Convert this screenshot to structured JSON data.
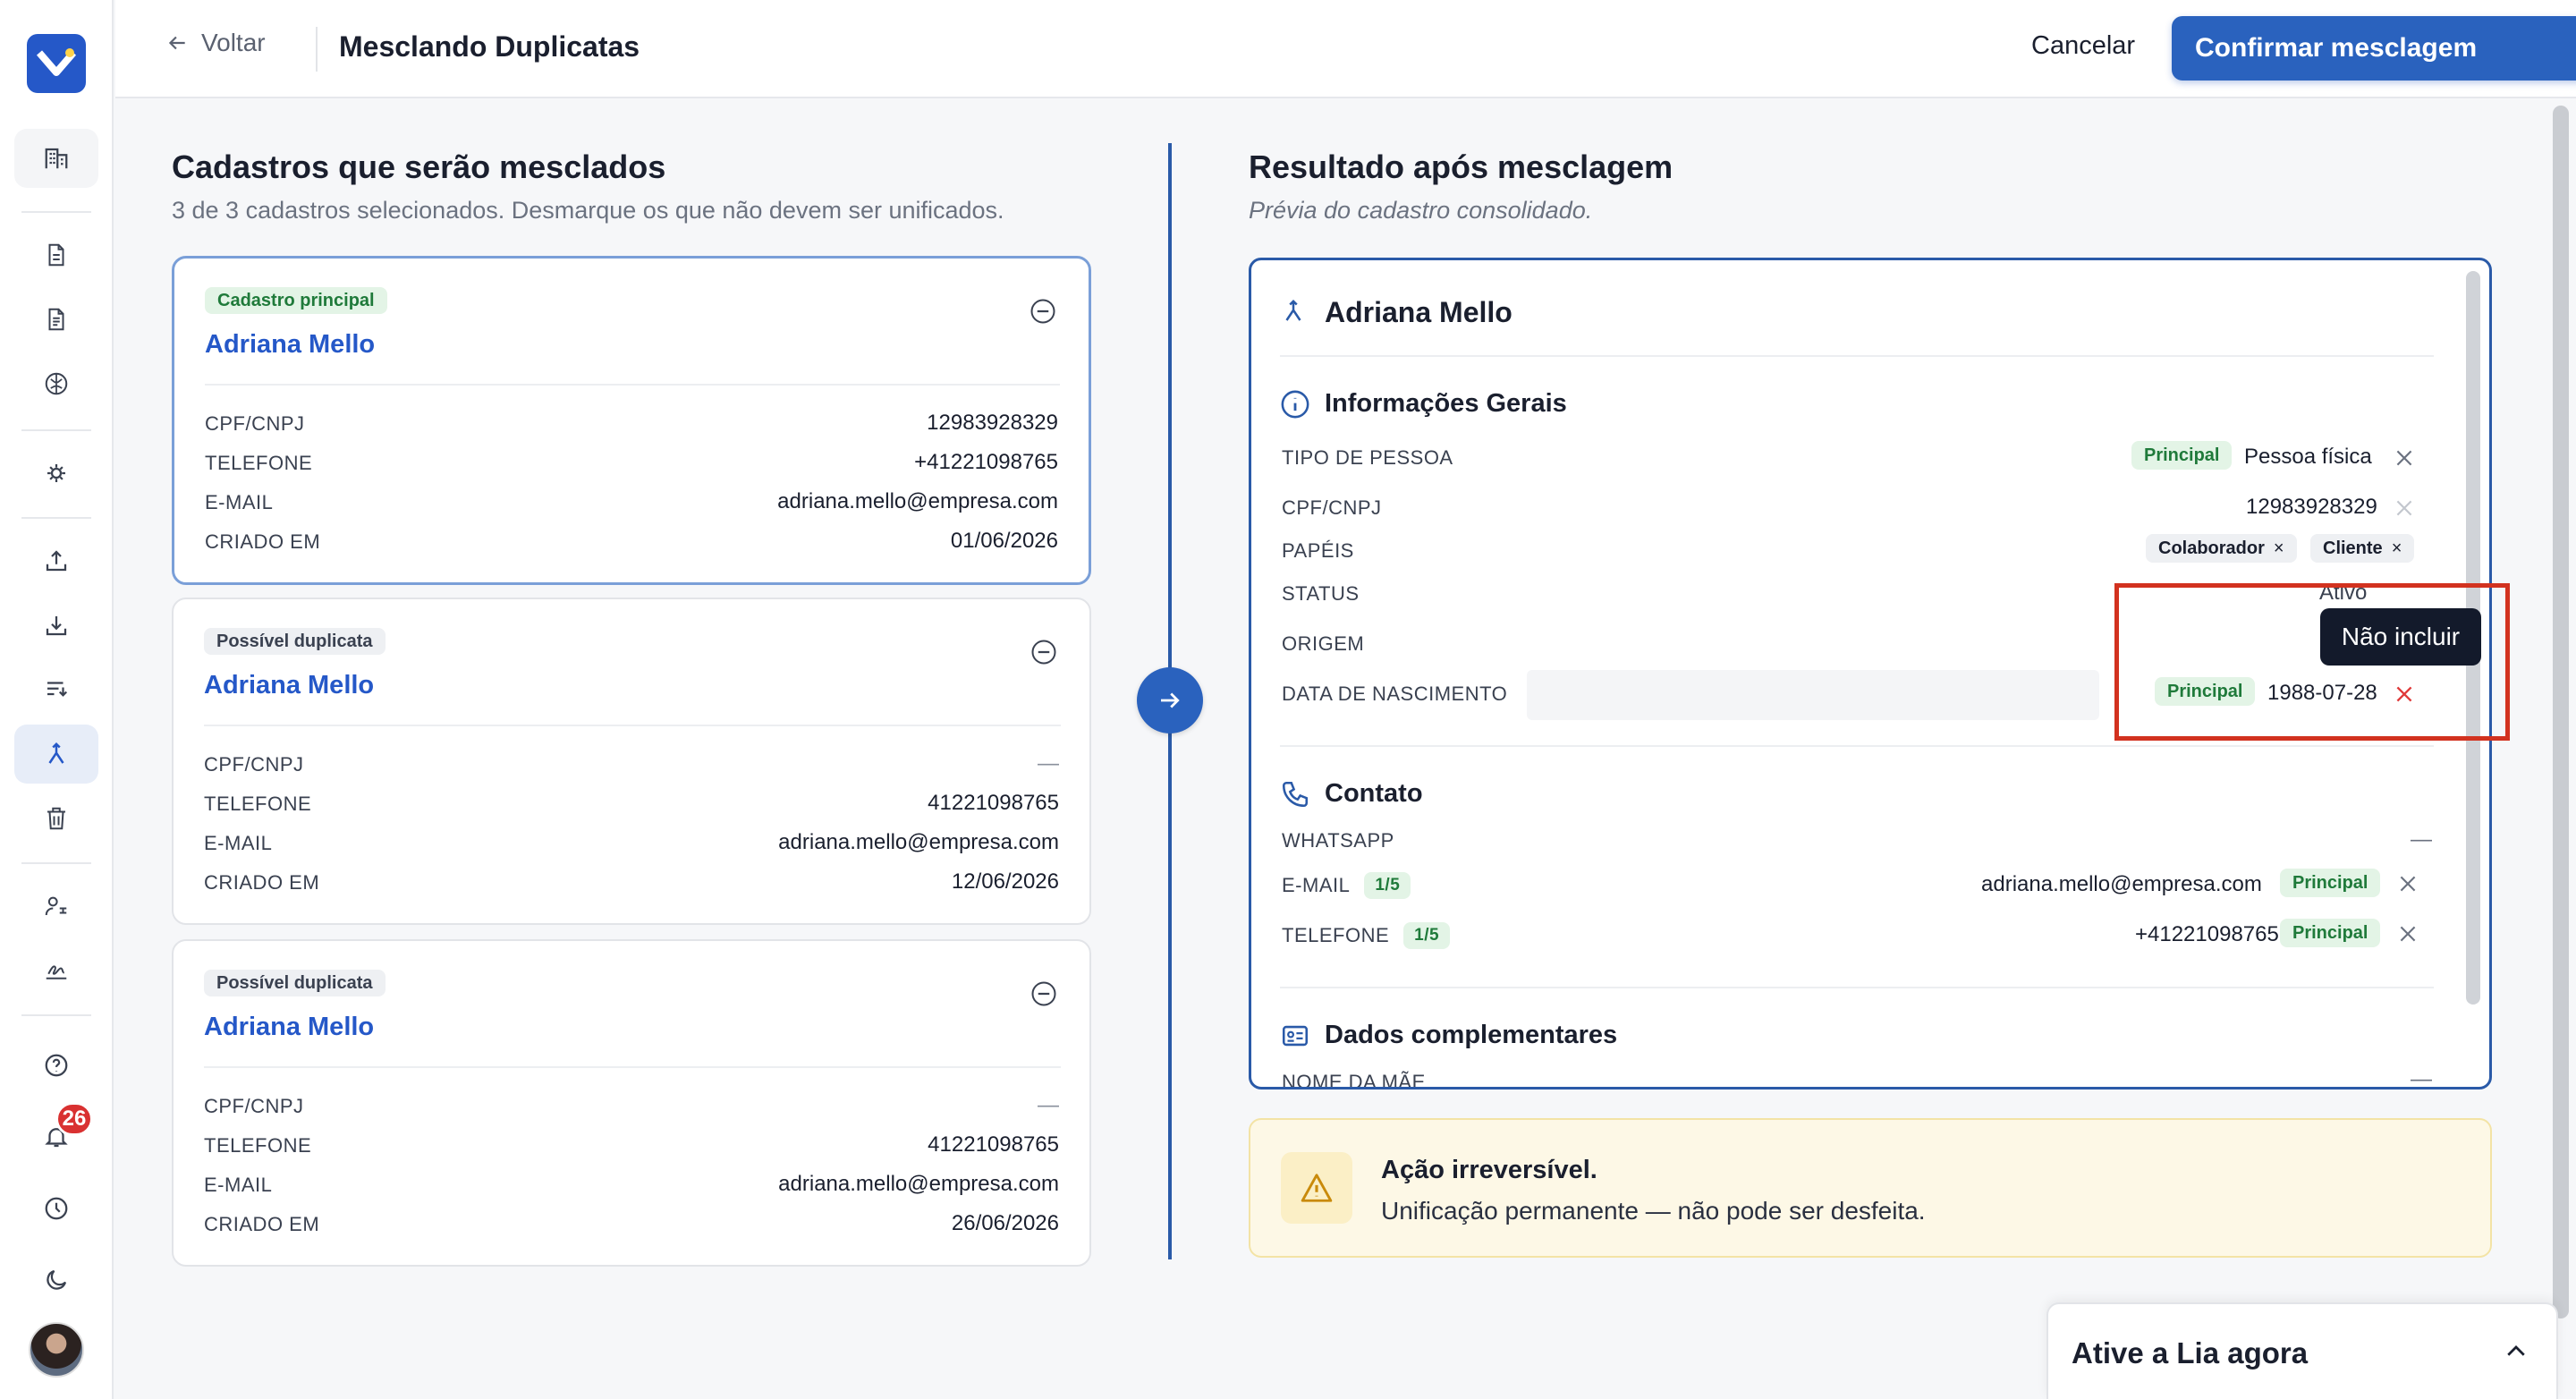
{
  "header": {
    "back_label": "Voltar",
    "title": "Mesclando Duplicatas",
    "cancel_label": "Cancelar",
    "confirm_label": "Confirmar mesclagem"
  },
  "sidebar": {
    "notification_count": "26",
    "items": [
      "building-icon",
      "document-icon",
      "document-lines-icon",
      "brain-icon",
      "gear-cluster-icon",
      "upload-icon",
      "download-icon",
      "list-filter-icon",
      "merge-icon",
      "trash-icon",
      "users-link-icon",
      "signature-icon",
      "help-icon",
      "bell-icon",
      "history-icon",
      "moon-icon"
    ]
  },
  "left": {
    "title": "Cadastros que serão mesclados",
    "subtitle": "3 de 3 cadastros selecionados. Desmarque os que não devem ser unificados.",
    "cards": [
      {
        "tag": "Cadastro principal",
        "name": "Adriana Mello",
        "fields": [
          {
            "k": "CPF/CNPJ",
            "v": "12983928329"
          },
          {
            "k": "TELEFONE",
            "v": "+41221098765"
          },
          {
            "k": "E-MAIL",
            "v": "adriana.mello@empresa.com"
          },
          {
            "k": "CRIADO EM",
            "v": "01/06/2026"
          }
        ]
      },
      {
        "tag": "Possível duplicata",
        "name": "Adriana Mello",
        "fields": [
          {
            "k": "CPF/CNPJ",
            "v": "—"
          },
          {
            "k": "TELEFONE",
            "v": "41221098765"
          },
          {
            "k": "E-MAIL",
            "v": "adriana.mello@empresa.com"
          },
          {
            "k": "CRIADO EM",
            "v": "12/06/2026"
          }
        ]
      },
      {
        "tag": "Possível duplicata",
        "name": "Adriana Mello",
        "fields": [
          {
            "k": "CPF/CNPJ",
            "v": "—"
          },
          {
            "k": "TELEFONE",
            "v": "41221098765"
          },
          {
            "k": "E-MAIL",
            "v": "adriana.mello@empresa.com"
          },
          {
            "k": "CRIADO EM",
            "v": "26/06/2026"
          }
        ]
      }
    ]
  },
  "right": {
    "title": "Resultado após mesclagem",
    "subtitle": "Prévia do cadastro consolidado.",
    "name": "Adriana Mello",
    "general": {
      "title": "Informações Gerais",
      "tipo_label": "TIPO DE PESSOA",
      "tipo_tag": "Principal",
      "tipo_value": "Pessoa física",
      "cpf_label": "CPF/CNPJ",
      "cpf_value": "12983928329",
      "papeis_label": "PAPÉIS",
      "papel_1": "Colaborador",
      "papel_2": "Cliente",
      "status_label": "STATUS",
      "status_value": "Ativo",
      "origem_label": "ORIGEM",
      "nasc_label": "DATA DE NASCIMENTO",
      "nasc_tag": "Principal",
      "nasc_value": "1988-07-28"
    },
    "contact": {
      "title": "Contato",
      "whatsapp_label": "WHATSAPP",
      "whatsapp_value": "—",
      "email_label": "E-MAIL",
      "email_count": "1/5",
      "email_value": "adriana.mello@empresa.com",
      "email_tag": "Principal",
      "phone_label": "TELEFONE",
      "phone_count": "1/5",
      "phone_value": "+41221098765",
      "phone_tag": "Principal"
    },
    "extra": {
      "title": "Dados complementares",
      "mae_label": "NOME DA MÃE",
      "mae_value": "—"
    },
    "tooltip": "Não incluir"
  },
  "warning": {
    "title": "Ação irreversível.",
    "text": "Unificação permanente — não pode ser desfeita."
  },
  "lia": {
    "label": "Ative a Lia agora"
  },
  "colors": {
    "accent": "#2a62be",
    "success": "#1f7a3a",
    "danger": "#d93131",
    "highlight": "#d2321f"
  }
}
